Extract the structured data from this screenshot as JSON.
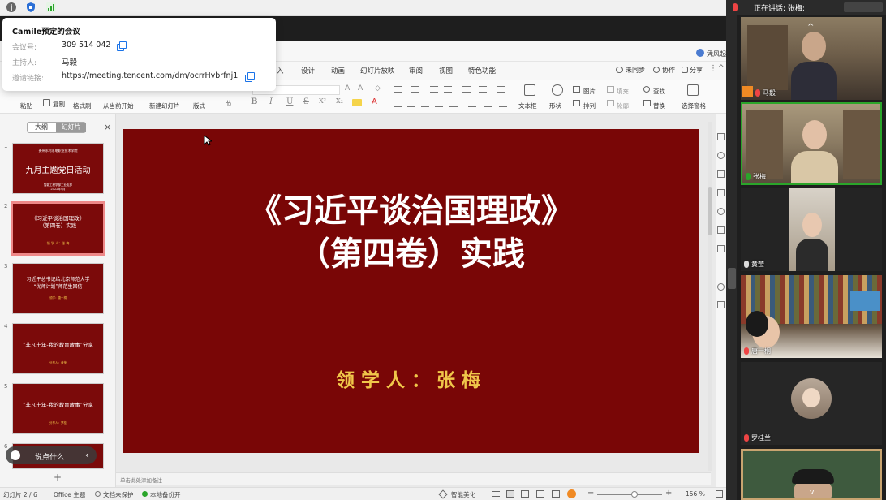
{
  "meeting_bar": {
    "icons": [
      "info-icon",
      "shield-icon",
      "signal-icon"
    ]
  },
  "meeting_info": {
    "title": "Camile预定的会议",
    "id_label": "会议号:",
    "id_value": "309 514 042",
    "host_label": "主持人:",
    "host_value": "马毅",
    "link_label": "邀请链接:",
    "link_value": "https://meeting.tencent.com/dm/ocrrHvbrfnj1"
  },
  "wps": {
    "user": "凭风起",
    "menu": [
      "入",
      "设计",
      "动画",
      "幻灯片放映",
      "审阅",
      "视图",
      "特色功能"
    ],
    "menu_right": [
      "未同步",
      "协作",
      "分享"
    ],
    "ribbon": {
      "paste": "粘贴",
      "copy": "复制",
      "format_painter": "格式刷",
      "from_current": "从当前开始",
      "new_slide": "新建幻灯片",
      "layout": "版式",
      "section": "节",
      "textbox": "文本框",
      "shape": "形状",
      "picture": "图片",
      "fill": "填充",
      "arrange": "排列",
      "outline": "轮廓",
      "find": "查找",
      "replace": "替换",
      "select_pane": "选择窗格"
    },
    "format_buttons": [
      "B",
      "I",
      "U",
      "S",
      "X²",
      "X₂"
    ]
  },
  "side_panel": {
    "tab_outline": "大纲",
    "tab_slides": "幻灯片",
    "close": "×",
    "add": "+",
    "thumbnails": [
      {
        "num": "1",
        "lines": [
          "贵州水利水电职业技术学院",
          "九月主题党日活动",
          "智能工程学部工业支部",
          "2022年9月"
        ]
      },
      {
        "num": "2",
        "lines": [
          "《习近平谈治国理政》",
          "（第四卷）实践",
          "领 学 人：张 梅"
        ]
      },
      {
        "num": "3",
        "lines": [
          "习近平总书记给北京师范大学",
          "“优师计划”师范生回信",
          "领学：唐一桐"
        ]
      },
      {
        "num": "4",
        "lines": [
          "“非凡十年-我的教育故事”分享",
          "分享人：黄莹"
        ]
      },
      {
        "num": "5",
        "lines": [
          "“非凡十年-我的教育故事”分享",
          "分享人：罗桂"
        ]
      },
      {
        "num": "6",
        "lines": [
          "",
          ""
        ]
      }
    ],
    "chat_prompt": "说点什么"
  },
  "slide": {
    "title_line1": "《习近平谈治国理政》",
    "title_line2": "（第四卷）实践",
    "presenter": "领学人：张梅"
  },
  "notes_placeholder": "单击此处添加备注",
  "status_bar": {
    "slide_info": "幻灯片 2 / 6",
    "theme": "Office 主题",
    "protect": "文档未保护",
    "backup": "本地备份开",
    "beautify": "智能美化",
    "zoom": "156 %",
    "zoom_minus": "−",
    "zoom_plus": "+"
  },
  "participants": {
    "speaking": "正在讲话: 张梅;",
    "tiles": [
      {
        "name": "马毅"
      },
      {
        "name": "张梅"
      },
      {
        "name": "黄莹"
      },
      {
        "name": "唐一桐"
      },
      {
        "name": "罗桂兰"
      },
      {
        "name": ""
      }
    ]
  },
  "colors": {
    "slide_bg": "#790606",
    "slide_title": "#ffffff",
    "presenter_text": "#f0c64a",
    "accent_blue": "#1a73e8",
    "panel_dark": "#1e1e1e"
  }
}
